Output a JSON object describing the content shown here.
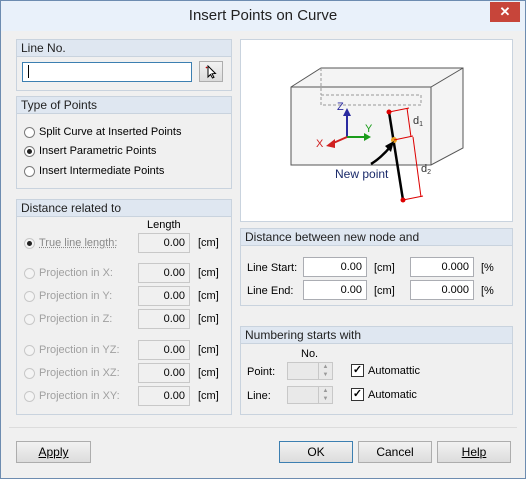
{
  "window": {
    "title": "Insert Points on Curve",
    "close_label": "✕"
  },
  "line_no": {
    "header": "Line No.",
    "value": "",
    "pick_icon": "cursor-pick-icon"
  },
  "type_of_points": {
    "header": "Type of Points",
    "options": [
      {
        "label": "Split Curve at Inserted Points",
        "selected": false
      },
      {
        "label": "Insert Parametric Points",
        "selected": true
      },
      {
        "label": "Insert Intermediate Points",
        "selected": false
      }
    ]
  },
  "distance_related": {
    "header": "Distance related to",
    "length_header": "Length",
    "rows": [
      {
        "label": "True line length:",
        "value": "0.00",
        "unit": "[cm]"
      },
      {
        "label": "Projection in X:",
        "value": "0.00",
        "unit": "[cm]"
      },
      {
        "label": "Projection in Y:",
        "value": "0.00",
        "unit": "[cm]"
      },
      {
        "label": "Projection in Z:",
        "value": "0.00",
        "unit": "[cm]"
      },
      {
        "label": "Projection in YZ:",
        "value": "0.00",
        "unit": "[cm]"
      },
      {
        "label": "Projection in XZ:",
        "value": "0.00",
        "unit": "[cm]"
      },
      {
        "label": "Projection in XY:",
        "value": "0.00",
        "unit": "[cm]"
      }
    ]
  },
  "diagram": {
    "z": "Z",
    "x": "X",
    "y": "Y",
    "d1": "d",
    "d1_sub": "1",
    "d2": "d",
    "d2_sub": "2",
    "new_point": "New point"
  },
  "distance_between": {
    "header": "Distance between new node and",
    "line_start_label": "Line Start:",
    "line_start_value": "0.00",
    "line_start_unit": "[cm]",
    "line_start_pct": "0.000",
    "line_start_pct_unit": "[%",
    "line_end_label": "Line End:",
    "line_end_value": "0.00",
    "line_end_unit": "[cm]",
    "line_end_pct": "0.000",
    "line_end_pct_unit": "[%"
  },
  "numbering": {
    "header": "Numbering starts with",
    "no_header": "No.",
    "point_label": "Point:",
    "point_check_label": "Automattic",
    "point_checked": true,
    "line_label": "Line:",
    "line_check_label": "Automatic",
    "line_checked": true
  },
  "buttons": {
    "apply": "Apply",
    "ok": "OK",
    "cancel": "Cancel",
    "help": "Help"
  }
}
